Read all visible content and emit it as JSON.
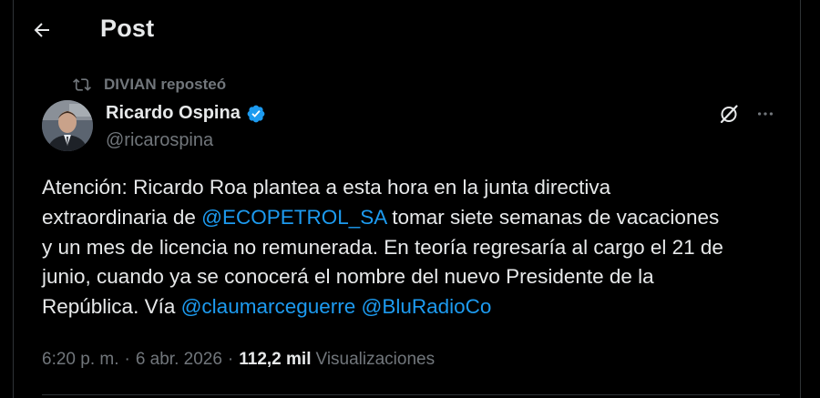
{
  "header": {
    "title": "Post",
    "back_icon": "arrow-left-icon"
  },
  "repost": {
    "icon": "repost-icon",
    "text": "DIVIAN reposteó"
  },
  "author": {
    "name": "Ricardo Ospina",
    "handle": "@ricarospina",
    "verified_icon": "verified-badge-icon",
    "verified_color": "#1d9bf0"
  },
  "actions": {
    "grok_icon": "grok-icon",
    "more_icon": "more-options-icon"
  },
  "tweet": {
    "line1": "Atención: Ricardo Roa plantea a esta hora en la junta directiva",
    "line2_pre": "extraordinaria de ",
    "line2_mention": "@ECOPETROL_SA",
    "line2_post": " tomar siete semanas de vacaciones",
    "line3": "y un mes de licencia no remunerada. En teoría regresaría al cargo el 21 de",
    "line4": "junio, cuando ya se conocerá el nombre del nuevo Presidente de la",
    "line5_pre": "República. Vía ",
    "line5_mention1": "@claumarceguerre",
    "line5_sep": " ",
    "line5_mention2": "@BluRadioCo"
  },
  "meta": {
    "time": "6:20 p. m.",
    "separator": "·",
    "date": "6 abr. 2026",
    "views_count": "112,2 mil",
    "views_label": "Visualizaciones"
  },
  "colors": {
    "background": "#000000",
    "text": "#e7e9ea",
    "secondary": "#71767b",
    "link": "#1d9bf0",
    "border": "#2f3336"
  }
}
